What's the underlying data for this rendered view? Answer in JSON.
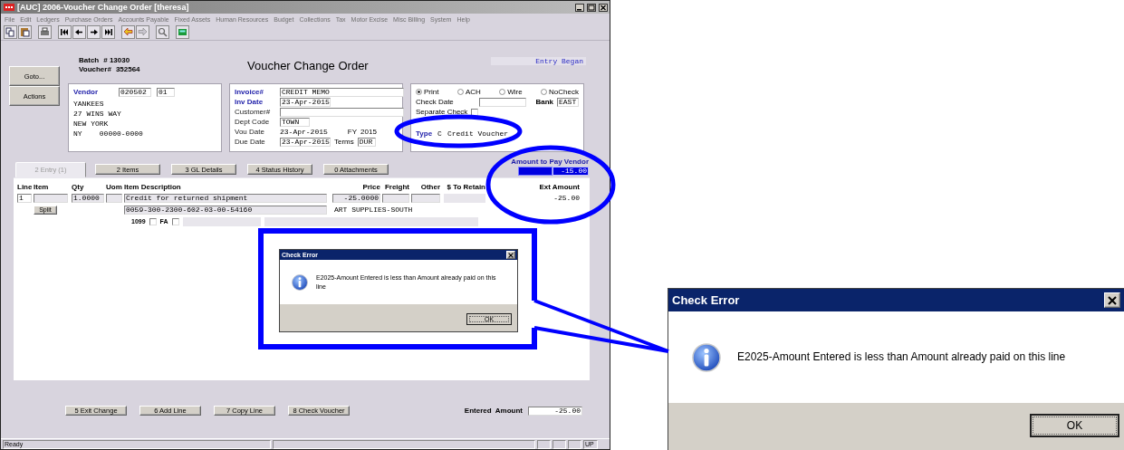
{
  "window": {
    "title": "[AUC] 2006-Voucher Change Order [theresa]"
  },
  "menu": [
    "File",
    "Edit",
    "Ledgers",
    "Purchase Orders",
    "Accounts Payable",
    "Fixed Assets",
    "Human Resources",
    "Budget",
    "Collections",
    "Tax",
    "Motor Excise",
    "Misc Billing",
    "System",
    "Help"
  ],
  "side_buttons": [
    "Goto...",
    "Actions"
  ],
  "batch": {
    "label": "Batch",
    "value": "# 13030"
  },
  "voucher": {
    "label": "Voucher#",
    "value": "352564"
  },
  "form_title": "Voucher Change Order",
  "entry_status": "Entry Began",
  "vendor": {
    "label": "Vendor",
    "code": "020502",
    "suffix": "01",
    "address": [
      "YANKEES",
      "27 WINS WAY",
      "NEW YORK",
      "NY    00000-0000"
    ]
  },
  "invoice_fields": [
    {
      "label": "Invoice#",
      "value": "CREDIT MEMO",
      "kind": "wide",
      "required": true
    },
    {
      "label": "Inv Date",
      "value": "23-Apr-2015",
      "kind": "date",
      "required": true
    },
    {
      "label": "Customer#",
      "kind": "wide",
      "required": false
    },
    {
      "label": "Dept Code",
      "value": "TOWN",
      "kind": "short",
      "required": false
    },
    {
      "label": "Vou Date",
      "value": "23-Apr-2015",
      "kind": "text",
      "required": false,
      "extra_label": "FY",
      "extra_value": "2015"
    },
    {
      "label": "Due Date",
      "value": "23-Apr-2015",
      "kind": "date",
      "required": false,
      "extra_label": "Terms",
      "extra_value": "DUR"
    }
  ],
  "payment": {
    "methods": [
      {
        "label": "Print",
        "selected": true
      },
      {
        "label": "ACH",
        "selected": false
      },
      {
        "label": "Wire",
        "selected": false
      },
      {
        "label": "NoCheck",
        "selected": false
      }
    ],
    "check_date_label": "Check Date",
    "bank_label": "Bank",
    "bank": "EAST",
    "separate_check_label": "Separate Check",
    "separate_check": false,
    "type_label": "Type",
    "type_code": "C",
    "type_name": "Credit Voucher"
  },
  "tabs": [
    {
      "label": "2 Entry (1)",
      "selected": true
    },
    {
      "label": "2 Items",
      "selected": false
    },
    {
      "label": "3 GL Details",
      "selected": false
    },
    {
      "label": "4 Status History",
      "selected": false
    },
    {
      "label": "0 Attachments",
      "selected": false
    }
  ],
  "amount_to_pay": {
    "label": "Amount to Pay Vendor",
    "value": "-15.00"
  },
  "grid": {
    "columns": [
      "Line",
      "Item",
      "Qty",
      "Uom",
      "Item Description",
      "Price",
      "Freight",
      "Other",
      "$ To Retain",
      "Ext Amount"
    ],
    "rows": [
      {
        "line": "1",
        "qty": "1.0000",
        "description": "Credit for returned shipment",
        "price": "-25.0000",
        "ext_amount": "-25.00",
        "split_button": "Split",
        "account": "0059-300-2300-602-03-00-54160",
        "account_name": "ART SUPPLIES-SOUTH",
        "flag_1099": "1099",
        "checked_1099": false,
        "flag_fa": "FA",
        "checked_fa": false
      }
    ]
  },
  "bottom_buttons": [
    "5 Exit Change",
    "6 Add Line",
    "7 Copy Line",
    "8 Check Voucher"
  ],
  "entered_amount": {
    "label": "Entered  Amount",
    "value": "-25.00"
  },
  "status_bar": {
    "text": "Ready",
    "indicator": "UP"
  },
  "dialog": {
    "title": "Check Error",
    "message": "E2025-Amount Entered is less than Amount already paid on this line",
    "button": "OK"
  },
  "dialog_zoomed": {
    "title": "Check Error",
    "message": "E2025-Amount Entered is less than Amount already paid on this line",
    "button": "OK"
  }
}
